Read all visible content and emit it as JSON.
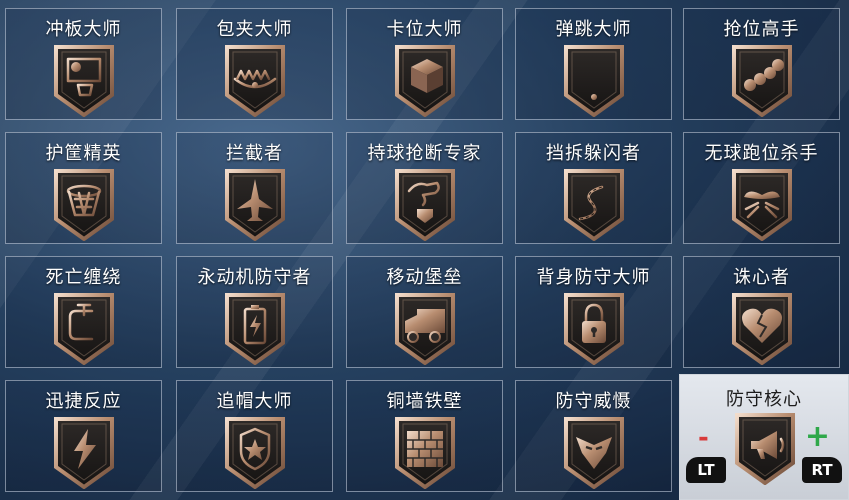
{
  "badges": [
    {
      "label": "冲板大师",
      "icon": "backboard-icon"
    },
    {
      "label": "包夹大师",
      "icon": "bear-trap-icon"
    },
    {
      "label": "卡位大师",
      "icon": "block-cube-icon"
    },
    {
      "label": "弹跳大师",
      "icon": "pogo-stick-icon"
    },
    {
      "label": "抢位高手",
      "icon": "worm-icon"
    },
    {
      "label": "护筐精英",
      "icon": "hoop-net-icon"
    },
    {
      "label": "拦截者",
      "icon": "fighter-jet-icon"
    },
    {
      "label": "持球抢断专家",
      "icon": "hand-grab-icon"
    },
    {
      "label": "挡拆躲闪者",
      "icon": "winding-road-icon"
    },
    {
      "label": "无球跑位杀手",
      "icon": "mosquito-icon"
    },
    {
      "label": "死亡缠绕",
      "icon": "clamp-icon"
    },
    {
      "label": "永动机防守者",
      "icon": "battery-icon"
    },
    {
      "label": "移动堡垒",
      "icon": "truck-icon"
    },
    {
      "label": "背身防守大师",
      "icon": "padlock-icon"
    },
    {
      "label": "诛心者",
      "icon": "broken-heart-icon"
    },
    {
      "label": "迅捷反应",
      "icon": "lightning-icon"
    },
    {
      "label": "追帽大师",
      "icon": "police-badge-icon"
    },
    {
      "label": "铜墙铁壁",
      "icon": "brick-wall-icon"
    },
    {
      "label": "防守威慑",
      "icon": "eagle-icon"
    }
  ],
  "selected": {
    "label": "防守核心",
    "icon": "megaphone-icon",
    "minus": "-",
    "plus": "+",
    "lt": "LT",
    "rt": "RT"
  },
  "colors": {
    "badge_dark": "#1e1a18",
    "badge_bronze": "#c7a38a",
    "minus": "#d83a3a",
    "plus": "#2fa84a"
  }
}
